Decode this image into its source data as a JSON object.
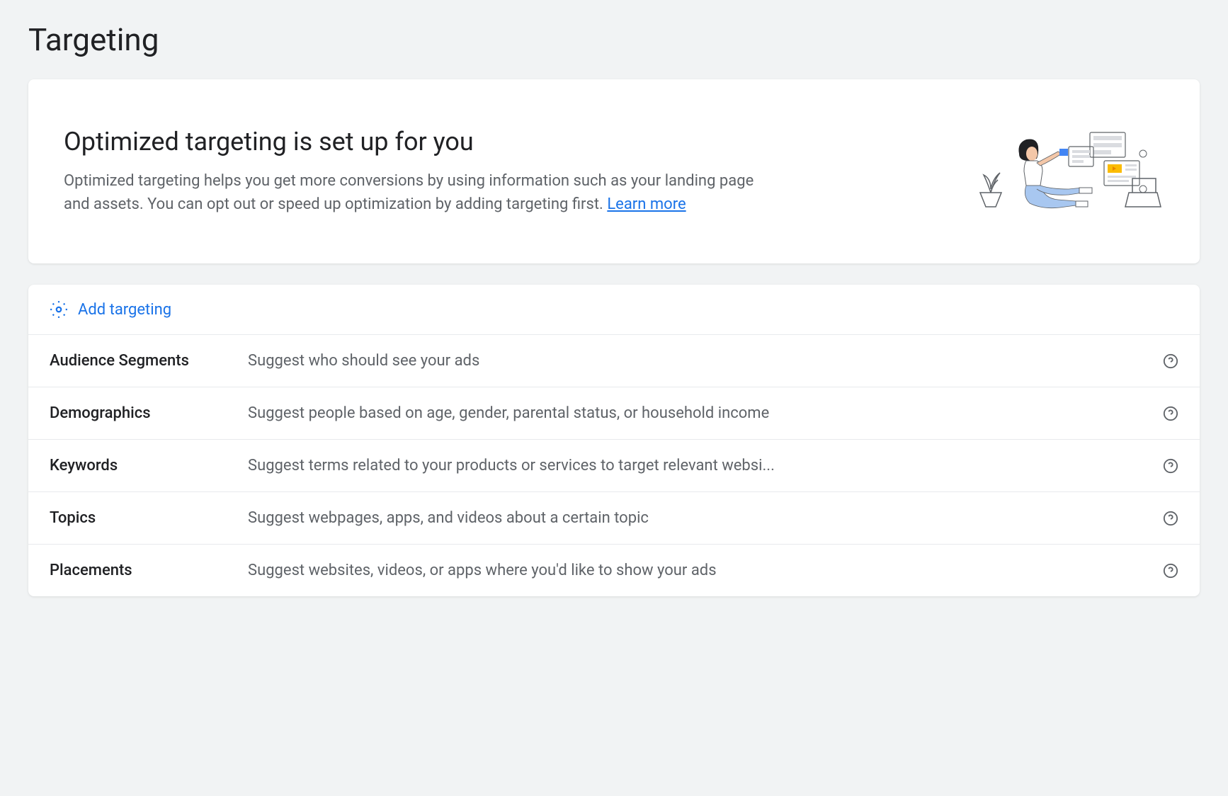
{
  "page": {
    "title": "Targeting"
  },
  "hero": {
    "title": "Optimized targeting is set up for you",
    "description": "Optimized targeting helps you get more conversions by using information such as your landing page and assets. You can opt out or speed up optimization by adding targeting first. ",
    "learn_more": "Learn more"
  },
  "add_targeting": {
    "label": "Add targeting"
  },
  "rows": [
    {
      "label": "Audience Segments",
      "description": "Suggest who should see your ads"
    },
    {
      "label": "Demographics",
      "description": "Suggest people based on age, gender, parental status, or household income"
    },
    {
      "label": "Keywords",
      "description": "Suggest terms related to your products or services to target relevant websi..."
    },
    {
      "label": "Topics",
      "description": "Suggest webpages, apps, and videos about a certain topic"
    },
    {
      "label": "Placements",
      "description": "Suggest websites, videos, or apps where you'd like to show your ads"
    }
  ]
}
